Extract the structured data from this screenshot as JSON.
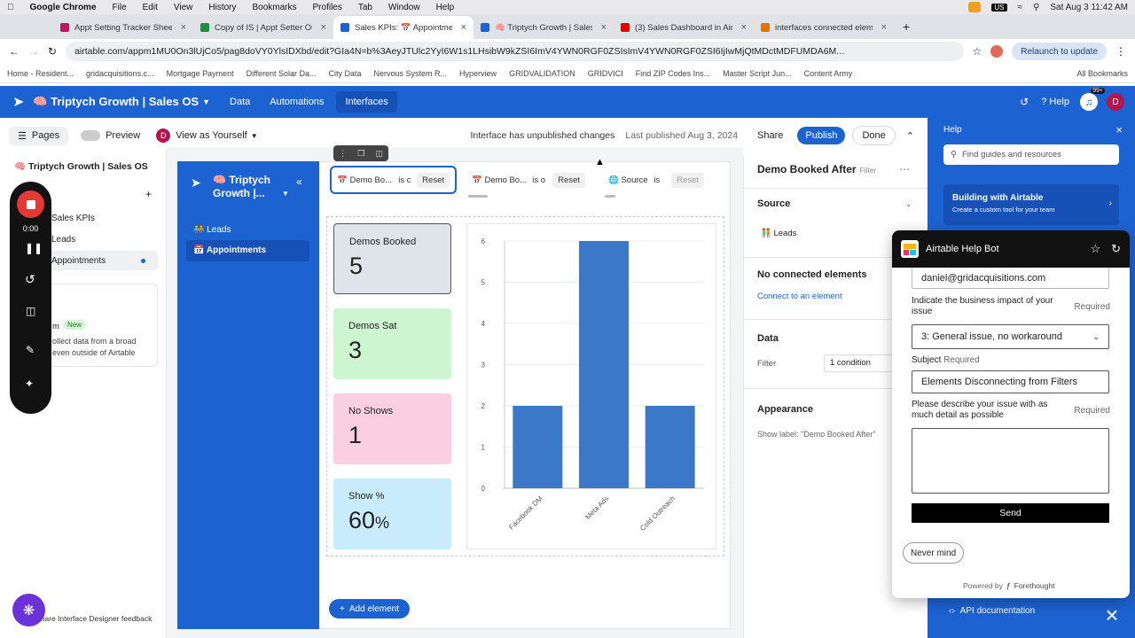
{
  "menubar": {
    "app": "Google Chrome",
    "items": [
      "File",
      "Edit",
      "View",
      "History",
      "Bookmarks",
      "Profiles",
      "Tab",
      "Window",
      "Help"
    ],
    "datetime": "Sat Aug 3  11:42 AM",
    "badge": "US"
  },
  "tabs": [
    {
      "title": "Appt Setting Tracker Sheet -",
      "color": "#c2185b"
    },
    {
      "title": "Copy of IS | Appt Setter Outre",
      "color": "#1e8e3e"
    },
    {
      "title": "Sales KPIs: 📅 Appointme",
      "color": "#1d62d1",
      "active": true
    },
    {
      "title": "🧠 Triptych Growth | Sales O",
      "color": "#1d62d1"
    },
    {
      "title": "(3) Sales Dashboard in Airtab",
      "color": "#e00000"
    },
    {
      "title": "interfaces connected element",
      "color": "#e37400"
    }
  ],
  "address": {
    "url": "airtable.com/appm1MU0On3lUjCo5/pag8doVY0YlsIDXbd/edit?GIa4N=b%3AeyJTUlc2YyI6W1s1LHsibW9kZSI6ImV4YWN0RGF0ZSIsImV4YWN0RGF0ZSI6IjIwMjQtMDctMDFUMDA6M...",
    "relaunch": "Relaunch to update"
  },
  "bookmarks": [
    "Home - Resident...",
    "gridacquisitions.c...",
    "Mortgage Payment",
    "Different Solar Da...",
    "City Data",
    "Nervous System R...",
    "Hyperview",
    "GRIDVALIDATION",
    "GRIDVICI",
    "Find ZIP Codes Ins...",
    "Master Script Jun...",
    "Content Army"
  ],
  "bookmarks_all": "All Bookmarks",
  "header": {
    "base_name": "🧠 Triptych Growth | Sales OS",
    "nav": [
      "Data",
      "Automations",
      "Interfaces"
    ],
    "help": "Help",
    "notif_badge": "99+",
    "avatar": "D"
  },
  "toolbar": {
    "pages": "Pages",
    "preview": "Preview",
    "view_as": "View as Yourself",
    "status": "Interface has unpublished changes",
    "last_published": "Last published Aug 3, 2024",
    "share": "Share",
    "publish": "Publish",
    "done": "Done"
  },
  "pages_panel": {
    "title": "🧠 Triptych Growth | Sales OS",
    "items": [
      "Sales KPIs",
      "Leads",
      "Appointments"
    ],
    "promo_new": "New",
    "promo_text": "ollect data from a broad even outside of Airtable",
    "promo_m": "m",
    "feedback": "Share Interface Designer feedback"
  },
  "recorder": {
    "time": "0:00"
  },
  "app": {
    "title": "🧠 Triptych Growth |...",
    "nav": [
      "🧑‍🤝‍🧑 Leads",
      "📅 Appointments"
    ]
  },
  "filters": [
    {
      "field": "📅 Demo Bo...",
      "op": "is c",
      "reset": "Reset"
    },
    {
      "field": "📅 Demo Bo...",
      "op": "is o",
      "reset": "Reset"
    },
    {
      "field": "🌐 Source",
      "op": "is",
      "reset": "Reset"
    }
  ],
  "cards": [
    {
      "label": "Demos Booked",
      "value": "5",
      "bg": "#dfe3ea"
    },
    {
      "label": "Demos Sat",
      "value": "3",
      "bg": "#cdf5cf"
    },
    {
      "label": "No Shows",
      "value": "1",
      "bg": "#fbcfe0"
    },
    {
      "label": "Show %",
      "value": "60",
      "unit": "%",
      "bg": "#c8ecfb"
    }
  ],
  "chart_data": {
    "type": "bar",
    "categories": [
      "Facebook DM",
      "Meta Ads",
      "Cold Outreach"
    ],
    "values": [
      2,
      6,
      2
    ],
    "yticks": [
      0,
      1,
      2,
      3,
      4,
      5,
      6
    ],
    "ylim": [
      0,
      6
    ],
    "color": "#3b78c7"
  },
  "add_element": "Add element",
  "props": {
    "title": "Demo Booked After",
    "subtitle": "Filter",
    "source_h": "Source",
    "source_val": "🧑‍🤝‍🧑 Leads",
    "noconn": "No connected elements",
    "connect": "Connect to an element",
    "data_h": "Data",
    "filter_lbl": "Filter",
    "filter_val": "1 condition",
    "appearance_h": "Appearance",
    "show_label": "Show label: \"Demo Booked After\""
  },
  "help": {
    "title": "Help",
    "search_placeholder": "Find guides and resources",
    "building": "Building with Airtable",
    "building_sub": "Create a custom tool for your team",
    "api": "API documentation"
  },
  "bot": {
    "title": "Airtable Help Bot",
    "email": "daniel@gridacquisitions.com",
    "impact_label": "Indicate the business impact of your issue",
    "required": "Required",
    "impact_val": "3: General issue, no workaround",
    "subject_label": "Subject",
    "subject_val": "Elements Disconnecting from Filters",
    "desc_label": "Please describe your issue with as much detail as possible",
    "send": "Send",
    "never": "Never mind",
    "powered": "Powered by",
    "brand": "Forethought"
  }
}
